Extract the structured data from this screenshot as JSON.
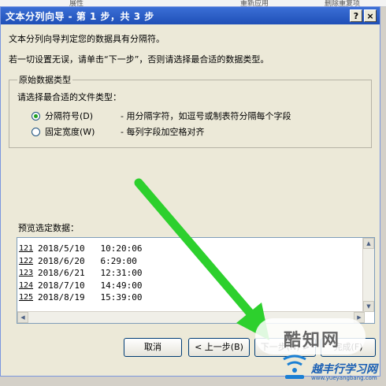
{
  "background": {
    "labels": [
      "展性",
      "重新应用",
      "删除重复项"
    ]
  },
  "dialog": {
    "title": "文本分列向导 - 第 1 步，共 3 步",
    "help_glyph": "?",
    "close_glyph": "×",
    "intro": "文本分列向导判定您的数据具有分隔符。",
    "hint": "若一切设置无误，请单击“下一步”，否则请选择最合适的数据类型。",
    "group_title": "原始数据类型",
    "group_subtitle": "请选择最合适的文件类型：",
    "options": [
      {
        "label": "分隔符号(D)",
        "description": "- 用分隔字符，如逗号或制表符分隔每个字段",
        "checked": true
      },
      {
        "label": "固定宽度(W)",
        "description": "- 每列字段加空格对齐",
        "checked": false
      }
    ],
    "preview_label": "预览选定数据：",
    "preview_rows": [
      {
        "num": "121",
        "text": "2018/5/10   10:20:06"
      },
      {
        "num": "122",
        "text": "2018/6/20   6:29:00"
      },
      {
        "num": "123",
        "text": "2018/6/21   12:31:00"
      },
      {
        "num": "124",
        "text": "2018/7/10   14:49:00"
      },
      {
        "num": "125",
        "text": "2018/8/19   15:39:00"
      }
    ],
    "buttons": {
      "cancel": "取消",
      "back": "< 上一步(B)",
      "next": "下一步(N) >",
      "finish": "完成(F)"
    }
  },
  "watermark": {
    "main": "酷知网",
    "brand": "越丰行学习网",
    "url": "www.yueyangbang.com"
  },
  "colors": {
    "arrow": "#2dd02d",
    "title_bar": "#245edb"
  }
}
